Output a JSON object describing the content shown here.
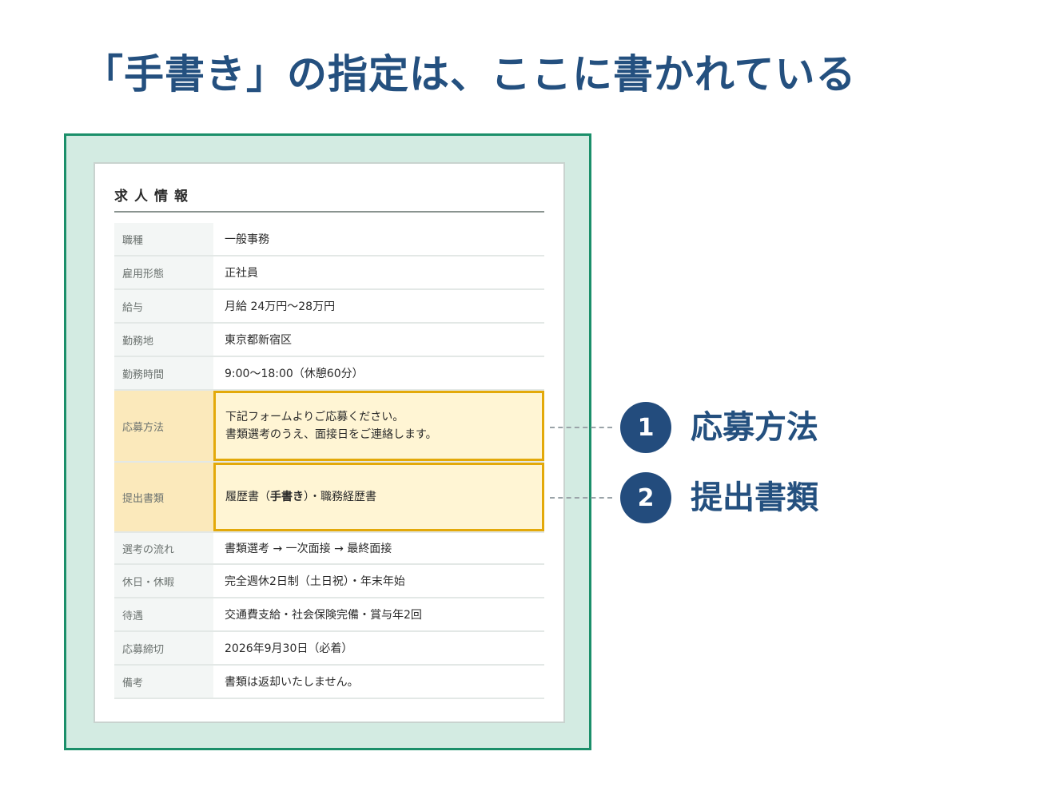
{
  "headline": "「手書き」の指定は、ここに書かれている",
  "card": {
    "title": "求人情報",
    "rows": [
      {
        "label": "職種",
        "value": "一般事務"
      },
      {
        "label": "雇用形態",
        "value": "正社員"
      },
      {
        "label": "給与",
        "value": "月給 24万円〜28万円"
      },
      {
        "label": "勤務地",
        "value": "東京都新宿区"
      },
      {
        "label": "勤務時間",
        "value": "9:00〜18:00（休憩60分）"
      }
    ],
    "application": {
      "label": "応募方法",
      "line1": "下記フォームよりご応募ください。",
      "line2": "書類選考のうえ、面接日をご連絡します。"
    },
    "documents": {
      "label": "提出書類",
      "prefix": "履歴書（",
      "bold": "手書き",
      "suffix": "）・職務経歴書"
    },
    "rows2": [
      {
        "label": "選考の流れ",
        "value": "書類選考 → 一次面接 → 最終面接"
      },
      {
        "label": "休日・休暇",
        "value": "完全週休2日制（土日祝）・年末年始"
      },
      {
        "label": "待遇",
        "value": "交通費支給・社会保険完備・賞与年2回"
      },
      {
        "label": "応募締切",
        "value": "2026年9月30日（必着）"
      },
      {
        "label": "備考",
        "value": "書類は返却いたしません。"
      }
    ]
  },
  "callouts": [
    {
      "number": "1",
      "label": "応募方法"
    },
    {
      "number": "2",
      "label": "提出書類"
    }
  ],
  "colors": {
    "headline": "#24507f",
    "frame_border": "#1b8f6a",
    "frame_fill": "#d3ebe2",
    "highlight_border": "#e3a90a",
    "highlight_fill": "#fff5d4",
    "badge": "#234c7d"
  }
}
